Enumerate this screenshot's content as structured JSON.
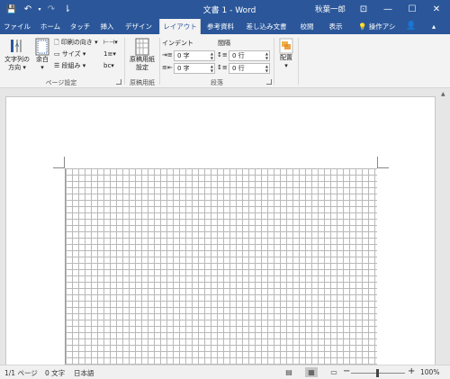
{
  "app": {
    "doc_title": "文書 1  -  Word",
    "user_name": "秋葉一郎",
    "qat": {
      "save": "💾",
      "undo": "↶",
      "redo": "↷",
      "customize": "⇂"
    },
    "window_buttons": {
      "ribbon_options": "⊡",
      "minimize": "—",
      "maximize": "☐",
      "close": "✕"
    }
  },
  "tabs": [
    {
      "label": "ファイル"
    },
    {
      "label": "ホーム"
    },
    {
      "label": "タッチ"
    },
    {
      "label": "挿入"
    },
    {
      "label": "デザイン"
    },
    {
      "label": "レイアウト",
      "active": true
    },
    {
      "label": "参考資料"
    },
    {
      "label": "差し込み文書"
    },
    {
      "label": "校閲"
    },
    {
      "label": "表示"
    }
  ],
  "tellme": "💡 操作アシ",
  "share_icon": "👤",
  "page_setup": {
    "text_direction": "文字列の\n方向 ▾",
    "margins": "余白",
    "orientation": "印刷の向き ▾",
    "size": "サイズ ▾",
    "columns": "段組み ▾",
    "group_label": "ページ設定"
  },
  "genko": {
    "button": "原稿用紙\n設定",
    "group_label": "原稿用紙"
  },
  "paragraph": {
    "indent_label": "インデント",
    "spacing_label": "間隔",
    "indent_left": "0 字",
    "indent_right": "0 字",
    "space_before": "0 行",
    "space_after": "0 行",
    "group_label": "段落"
  },
  "arrange": {
    "button": "配置\n▾"
  },
  "status": {
    "page": "1/1 ページ",
    "words": "0 文字",
    "language": "日本語",
    "zoom_minus": "−",
    "zoom_plus": "+",
    "zoom": "100%",
    "zoom_level": 0.5
  }
}
